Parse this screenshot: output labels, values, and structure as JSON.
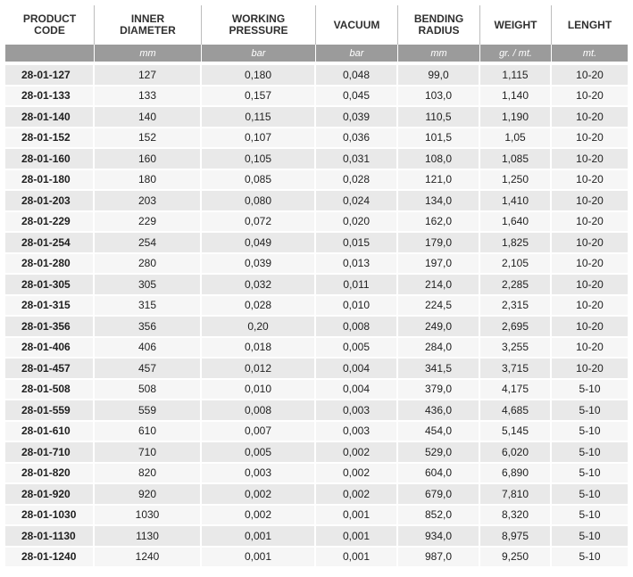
{
  "columns": [
    {
      "title": "PRODUCT\nCODE",
      "unit": ""
    },
    {
      "title": "INNER\nDIAMETER",
      "unit": "mm"
    },
    {
      "title": "WORKING\nPRESSURE",
      "unit": "bar"
    },
    {
      "title": "VACUUM",
      "unit": "bar"
    },
    {
      "title": "BENDING\nRADIUS",
      "unit": "mm"
    },
    {
      "title": "WEIGHT",
      "unit": "gr. / mt."
    },
    {
      "title": "LENGHT",
      "unit": "mt."
    }
  ],
  "rows": [
    [
      "28-01-127",
      "127",
      "0,180",
      "0,048",
      "99,0",
      "1,115",
      "10-20"
    ],
    [
      "28-01-133",
      "133",
      "0,157",
      "0,045",
      "103,0",
      "1,140",
      "10-20"
    ],
    [
      "28-01-140",
      "140",
      "0,115",
      "0,039",
      "110,5",
      "1,190",
      "10-20"
    ],
    [
      "28-01-152",
      "152",
      "0,107",
      "0,036",
      "101,5",
      "1,05",
      "10-20"
    ],
    [
      "28-01-160",
      "160",
      "0,105",
      "0,031",
      "108,0",
      "1,085",
      "10-20"
    ],
    [
      "28-01-180",
      "180",
      "0,085",
      "0,028",
      "121,0",
      "1,250",
      "10-20"
    ],
    [
      "28-01-203",
      "203",
      "0,080",
      "0,024",
      "134,0",
      "1,410",
      "10-20"
    ],
    [
      "28-01-229",
      "229",
      "0,072",
      "0,020",
      "162,0",
      "1,640",
      "10-20"
    ],
    [
      "28-01-254",
      "254",
      "0,049",
      "0,015",
      "179,0",
      "1,825",
      "10-20"
    ],
    [
      "28-01-280",
      "280",
      "0,039",
      "0,013",
      "197,0",
      "2,105",
      "10-20"
    ],
    [
      "28-01-305",
      "305",
      "0,032",
      "0,011",
      "214,0",
      "2,285",
      "10-20"
    ],
    [
      "28-01-315",
      "315",
      "0,028",
      "0,010",
      "224,5",
      "2,315",
      "10-20"
    ],
    [
      "28-01-356",
      "356",
      "0,20",
      "0,008",
      "249,0",
      "2,695",
      "10-20"
    ],
    [
      "28-01-406",
      "406",
      "0,018",
      "0,005",
      "284,0",
      "3,255",
      "10-20"
    ],
    [
      "28-01-457",
      "457",
      "0,012",
      "0,004",
      "341,5",
      "3,715",
      "10-20"
    ],
    [
      "28-01-508",
      "508",
      "0,010",
      "0,004",
      "379,0",
      "4,175",
      "5-10"
    ],
    [
      "28-01-559",
      "559",
      "0,008",
      "0,003",
      "436,0",
      "4,685",
      "5-10"
    ],
    [
      "28-01-610",
      "610",
      "0,007",
      "0,003",
      "454,0",
      "5,145",
      "5-10"
    ],
    [
      "28-01-710",
      "710",
      "0,005",
      "0,002",
      "529,0",
      "6,020",
      "5-10"
    ],
    [
      "28-01-820",
      "820",
      "0,003",
      "0,002",
      "604,0",
      "6,890",
      "5-10"
    ],
    [
      "28-01-920",
      "920",
      "0,002",
      "0,002",
      "679,0",
      "7,810",
      "5-10"
    ],
    [
      "28-01-1030",
      "1030",
      "0,002",
      "0,001",
      "852,0",
      "8,320",
      "5-10"
    ],
    [
      "28-01-1130",
      "1130",
      "0,001",
      "0,001",
      "934,0",
      "8,975",
      "5-10"
    ],
    [
      "28-01-1240",
      "1240",
      "0,001",
      "0,001",
      "987,0",
      "9,250",
      "5-10"
    ]
  ],
  "colors": {
    "unit_row": "#9b9b9b",
    "row_dark": "#e9e9e9",
    "row_light": "#f6f6f6"
  }
}
